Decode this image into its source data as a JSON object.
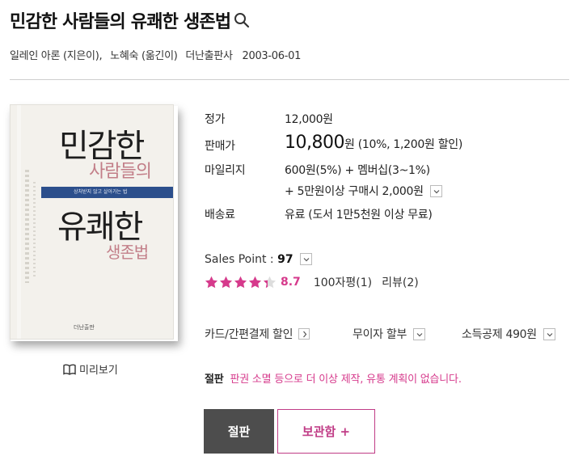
{
  "book": {
    "title": "민감한 사람들의 유쾌한 생존법",
    "author": "일레인 아론 (지은이),",
    "translator": "노혜숙 (옮긴이)",
    "publisher": "더난출판사",
    "date": "2003-06-01"
  },
  "cover": {
    "line1": "민감한",
    "line2": "사람들의",
    "band": "상처받지 않고 살아가는 법",
    "line3": "유쾌한",
    "line4": "생존법",
    "publisher_mark": "더난출판"
  },
  "preview_label": "미리보기",
  "price": {
    "list_label": "정가",
    "list_value": "12,000원",
    "sale_label": "판매가",
    "sale_value": "10,800",
    "sale_unit": "원",
    "sale_discount": "(10%, 1,200원 할인)",
    "mileage_label": "마일리지",
    "mileage_value": "600원(5%) + 멤버십(3~1%)",
    "mileage_extra": "+ 5만원이상 구매시 2,000원",
    "shipping_label": "배송료",
    "shipping_value": "유료 (도서 1만5천원 이상 무료)"
  },
  "sales_point": {
    "label": "Sales Point :",
    "value": "97"
  },
  "rating": {
    "score_value": 4.35,
    "max": 5,
    "score": "8.7",
    "reviews_100": "100자평(1)",
    "reviews": "리뷰(2)"
  },
  "extras": {
    "card": "카드/간편결제 할인",
    "installment": "무이자 할부",
    "tax": "소득공제 490원"
  },
  "notice": {
    "tag": "절판",
    "message": "판권 소멸 등으로 더 이상 제작, 유통 계획이 없습니다."
  },
  "buttons": {
    "out_of_print": "절판",
    "wishlist": "보관함 +"
  },
  "colors": {
    "accent": "#d63a8c",
    "dark_button": "#4d4d4d"
  }
}
